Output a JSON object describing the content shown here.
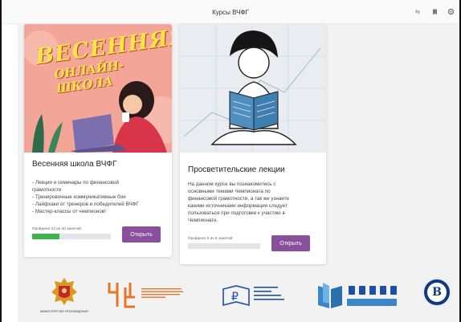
{
  "app": {
    "title": "Курсы ВЧФГ"
  },
  "toolbar": {
    "icons": [
      "translate-icon",
      "bookmark-icon",
      "settings-icon"
    ]
  },
  "courses": [
    {
      "hero_line1": "ВЕСЕННЯЯ",
      "hero_line2": "ОНЛАЙН-ШКОЛА",
      "title": "Весенняя школа ВЧФГ",
      "description_lines": [
        "- Лекции и семинары по финансовой",
        "грамотности",
        "- Тренировочные коммуникативные бои",
        "- Лайфхаки от тренеров и победителей ВЧФГ",
        "- Мастер-классы от чемпионов!"
      ],
      "progress_text": "Пройдено 14 из 40 занятий",
      "progress": 0.35,
      "button_label": "Открыть"
    },
    {
      "title": "Просветительские лекции",
      "description_lines": [
        "На данном курсе вы познакомитесь с",
        "основными темами Чемпионата по",
        "финансовой грамотности, а так же узнаете",
        "какими источниками информации следует",
        "пользоваться при подготовке к участию в",
        "Чемпионате."
      ],
      "progress_text": "Пройдено 0 из 6 занятий",
      "progress": 0,
      "button_label": "Открыть"
    }
  ],
  "partners": {
    "ministry_label": "МИНИСТЕРСТВО ПРОСВЕЩЕНИЯ",
    "hse_initial": "В",
    "colors": {
      "accent": "#8a4f9a",
      "progress": "#3fb34f",
      "brand_blue": "#1d4fa3",
      "hse_blue": "#123a7a",
      "orange": "#e8742a"
    }
  }
}
